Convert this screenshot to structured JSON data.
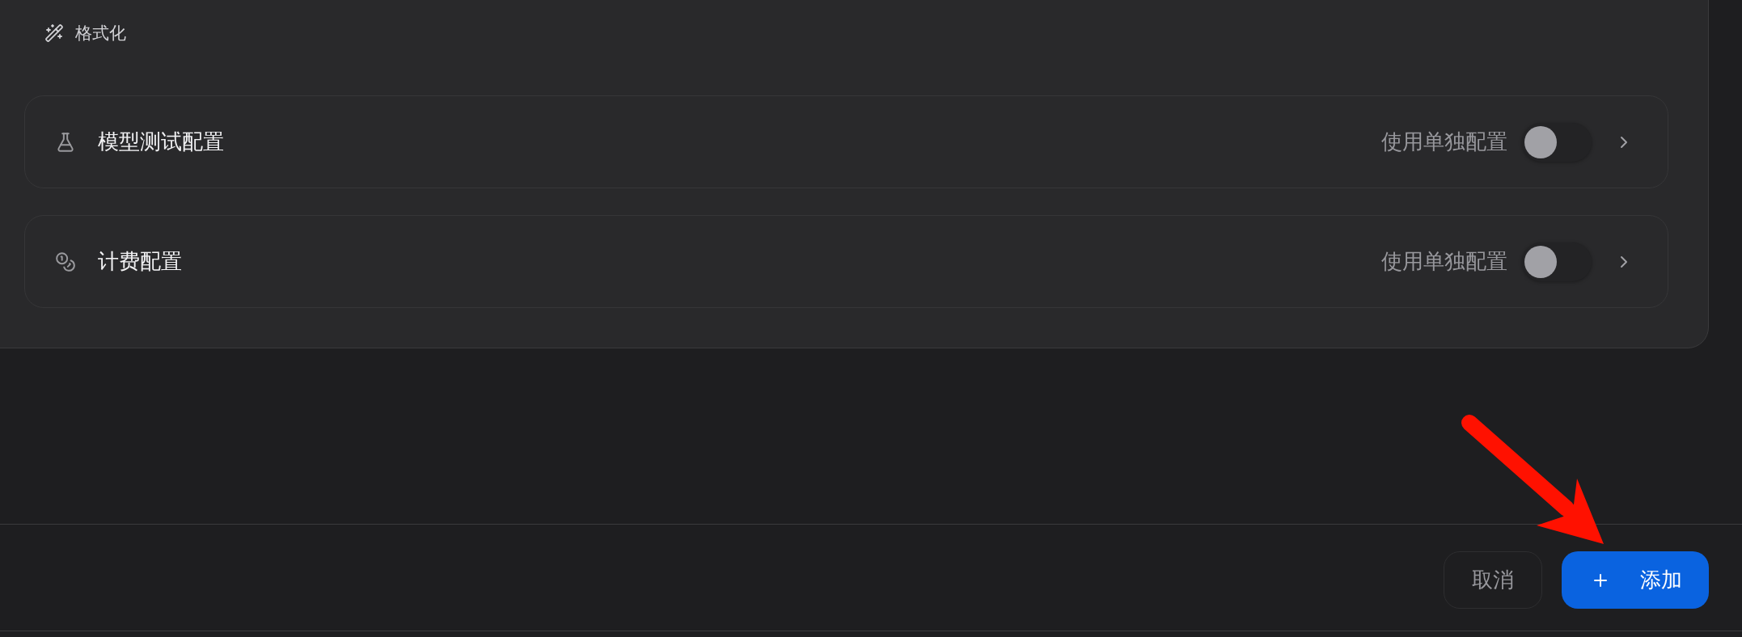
{
  "toolbar": {
    "format_button": {
      "label": "格式化"
    }
  },
  "sections": [
    {
      "title": "模型测试配置",
      "toggle_label": "使用单独配置",
      "on": false
    },
    {
      "title": "计费配置",
      "toggle_label": "使用单独配置",
      "on": false
    }
  ],
  "footer": {
    "buttons": [
      {
        "label": "取消",
        "kind": "secondary"
      },
      {
        "label": "添加",
        "kind": "primary"
      }
    ]
  }
}
